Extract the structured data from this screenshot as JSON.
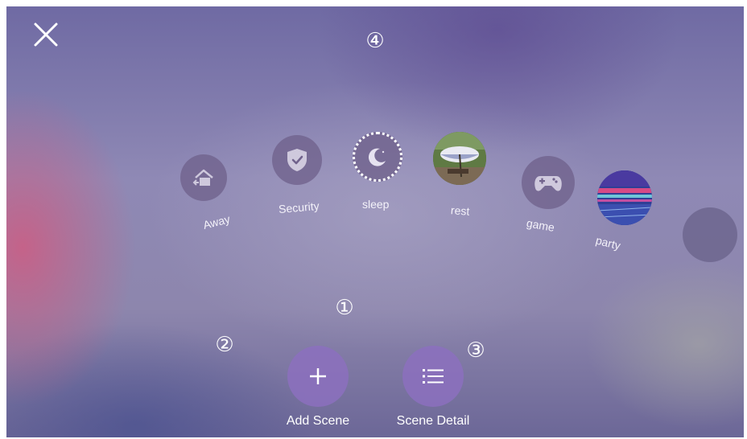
{
  "header": {
    "close_icon": "close-icon",
    "marker_4": "④"
  },
  "scenes": [
    {
      "label": "Away",
      "icon": "home-away-icon"
    },
    {
      "label": "Security",
      "icon": "shield-check-icon"
    },
    {
      "label": "sleep",
      "icon": "moon-icon"
    },
    {
      "label": "rest",
      "icon": "umbrella-photo"
    },
    {
      "label": "game",
      "icon": "gamepad-icon"
    },
    {
      "label": "party",
      "icon": "party-photo"
    },
    {
      "label": "",
      "icon": "empty-circle"
    }
  ],
  "markers": {
    "marker_1": "①",
    "marker_2": "②",
    "marker_3": "③"
  },
  "actions": {
    "add_label": "Add Scene",
    "add_icon": "plus-icon",
    "detail_label": "Scene Detail",
    "detail_icon": "list-icon"
  },
  "colors": {
    "accent": "#8c70be",
    "scene_circle": "#70628c"
  }
}
